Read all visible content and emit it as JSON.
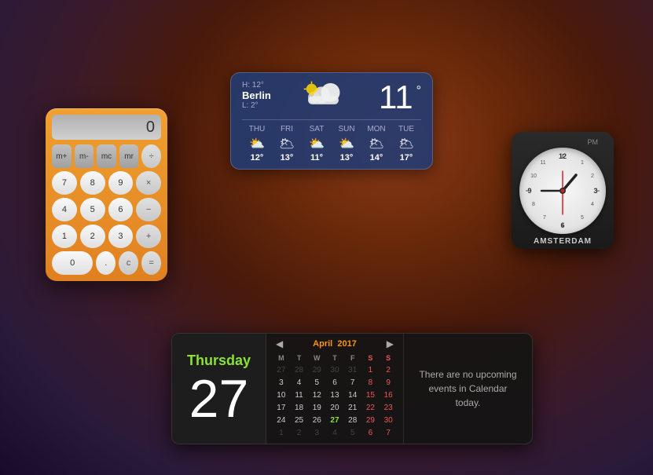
{
  "calculator": {
    "display": "0",
    "buttons": {
      "row1": [
        "m+",
        "m-",
        "mc",
        "mr",
        "÷"
      ],
      "row2": [
        "7",
        "8",
        "9",
        "×"
      ],
      "row3": [
        "4",
        "5",
        "6",
        "−"
      ],
      "row4": [
        "1",
        "2",
        "3",
        "+"
      ],
      "row5_left": [
        "0",
        "."
      ],
      "row5_right": [
        "c",
        "="
      ]
    }
  },
  "weather": {
    "high": "H: 12°",
    "low": "L: 2°",
    "city": "Berlin",
    "temp": "11",
    "unit": "°",
    "forecast": [
      {
        "day": "THU",
        "temp": "12°",
        "icon": "⛅"
      },
      {
        "day": "FRI",
        "temp": "13°",
        "icon": "🌥"
      },
      {
        "day": "SAT",
        "temp": "11°",
        "icon": "⛅"
      },
      {
        "day": "SUN",
        "temp": "13°",
        "icon": "⛅"
      },
      {
        "day": "MON",
        "temp": "14°",
        "icon": "🌥"
      },
      {
        "day": "TUE",
        "temp": "17°",
        "icon": "🌥"
      }
    ]
  },
  "clock": {
    "city": "AMSTERDAM",
    "period": "PM",
    "hour_angle": 30,
    "minute_angle": 165,
    "second_angle": 270
  },
  "calendar": {
    "day_name": "Thursday",
    "day_num": "27",
    "month_title": "April",
    "year": "2017",
    "headers": [
      "M",
      "T",
      "W",
      "T",
      "F",
      "S",
      "S"
    ],
    "rows": [
      [
        "27",
        "28",
        "29",
        "30",
        "31",
        "1",
        "2"
      ],
      [
        "3",
        "4",
        "5",
        "6",
        "7",
        "8",
        "9"
      ],
      [
        "10",
        "11",
        "12",
        "13",
        "14",
        "15",
        "16"
      ],
      [
        "17",
        "18",
        "19",
        "20",
        "21",
        "22",
        "23"
      ],
      [
        "24",
        "25",
        "26",
        "27",
        "28",
        "29",
        "30"
      ],
      [
        "1",
        "2",
        "3",
        "4",
        "5",
        "6",
        "7"
      ]
    ],
    "today_date": "27",
    "no_events_text": "There are no upcoming events in Calendar today."
  }
}
